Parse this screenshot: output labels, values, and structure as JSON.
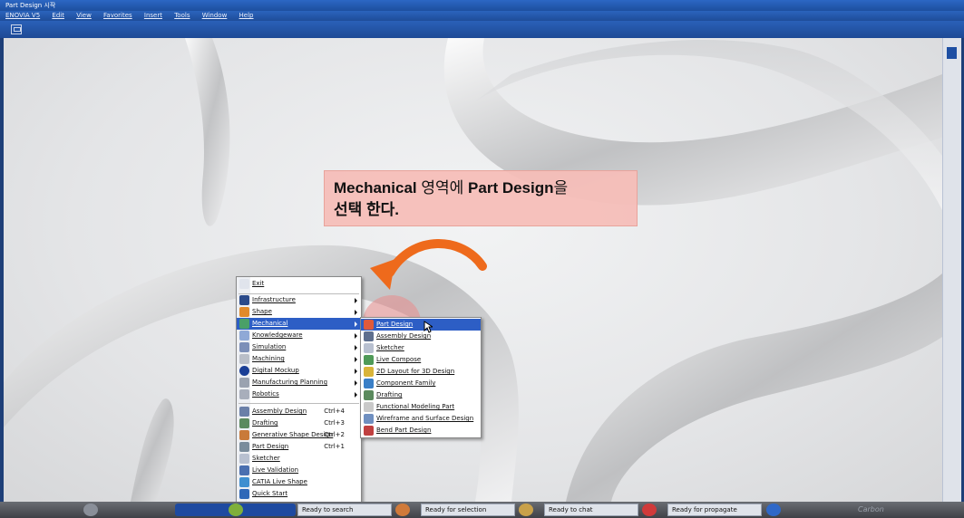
{
  "window": {
    "title": "Part Design 시작"
  },
  "menubar": {
    "items": [
      "ENOVIA V5",
      "Edit",
      "View",
      "Favorites",
      "Insert",
      "Tools",
      "Window",
      "Help"
    ]
  },
  "callout": {
    "line1_bold": "Mechanical",
    "line1_mid": " 영역에 ",
    "line1_bold2": "Part Design",
    "line1_end": "을",
    "line2": "선택 한다."
  },
  "start_menu": {
    "exit": "Exit",
    "categories": [
      {
        "label": "Infrastructure",
        "icon": "infrastructure-icon"
      },
      {
        "label": "Shape",
        "icon": "shape-icon"
      },
      {
        "label": "Mechanical",
        "icon": "mechanical-icon",
        "selected": true
      },
      {
        "label": "Knowledgeware",
        "icon": "knowledgeware-icon"
      },
      {
        "label": "Simulation",
        "icon": "simulation-icon"
      },
      {
        "label": "Machining",
        "icon": "machining-icon"
      },
      {
        "label": "Digital Mockup",
        "icon": "digital-mockup-icon"
      },
      {
        "label": "Manufacturing Planning",
        "icon": "manufacturing-planning-icon"
      },
      {
        "label": "Robotics",
        "icon": "robotics-icon"
      }
    ],
    "recent": [
      {
        "label": "Assembly Design",
        "shortcut": "Ctrl+4"
      },
      {
        "label": "Drafting",
        "shortcut": "Ctrl+3"
      },
      {
        "label": "Generative Shape Design",
        "shortcut": "Ctrl+2"
      },
      {
        "label": "Part Design",
        "shortcut": "Ctrl+1"
      },
      {
        "label": "Sketcher",
        "shortcut": ""
      },
      {
        "label": "Live Validation",
        "shortcut": ""
      },
      {
        "label": "CATIA Live Shape",
        "shortcut": ""
      },
      {
        "label": "Quick Start",
        "shortcut": ""
      }
    ]
  },
  "submenu": {
    "items": [
      {
        "label": "Part Design",
        "selected": true
      },
      {
        "label": "Assembly Design"
      },
      {
        "label": "Sketcher"
      },
      {
        "label": "Live Compose"
      },
      {
        "label": "2D Layout for 3D Design"
      },
      {
        "label": "Component Family"
      },
      {
        "label": "Drafting"
      },
      {
        "label": "Functional Modeling Part"
      },
      {
        "label": "Wireframe and Surface Design"
      },
      {
        "label": "Bend Part Design"
      }
    ]
  },
  "taskbar": {
    "search": "Ready to search",
    "selection": "Ready for selection",
    "chat": "Ready to chat",
    "propagate": "Ready for propagate",
    "brand": "Carbon"
  },
  "colors": {
    "accent": "#2d5ec5",
    "callout": "#f6beb8",
    "arrow": "#ee6a1c"
  }
}
